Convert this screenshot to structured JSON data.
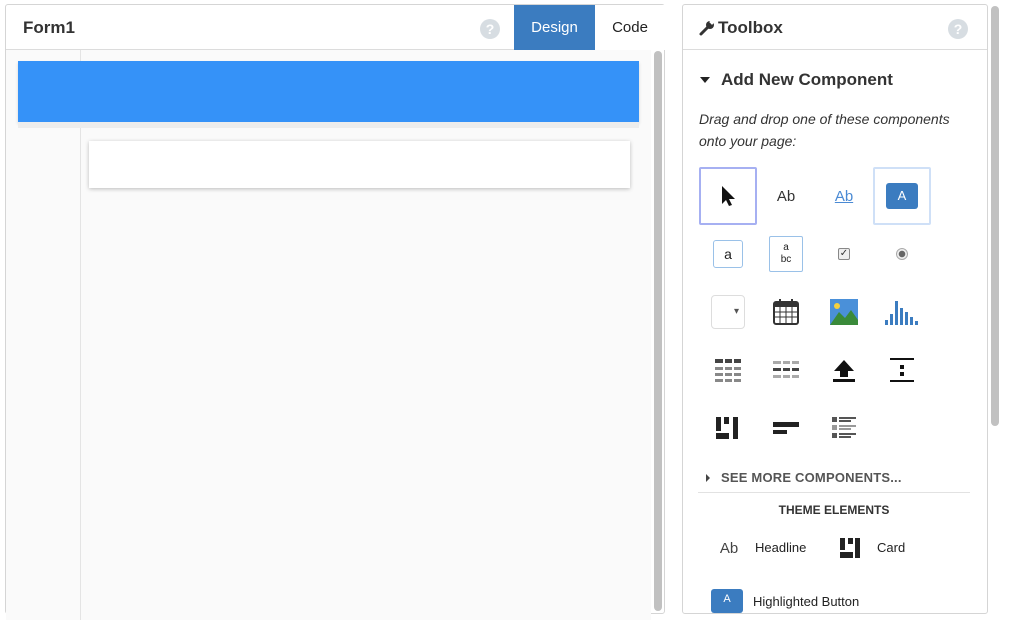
{
  "designer": {
    "title": "Form1",
    "help_glyph": "?",
    "tabs": [
      {
        "label": "Design",
        "active": true
      },
      {
        "label": "Code",
        "active": false
      }
    ]
  },
  "toolbox": {
    "title": "Toolbox",
    "help_glyph": "?",
    "section_title": "Add New Component",
    "instructions": "Drag and drop one of these components onto your page:",
    "components": [
      {
        "name": "pointer",
        "icon": "pointer-icon",
        "label": ""
      },
      {
        "name": "label",
        "icon": "label-icon",
        "label": "Ab"
      },
      {
        "name": "link",
        "icon": "link-icon",
        "label": "Ab"
      },
      {
        "name": "button",
        "icon": "button-icon",
        "label": "A"
      },
      {
        "name": "textbox",
        "icon": "textbox-icon",
        "label": "a"
      },
      {
        "name": "textarea",
        "icon": "textarea-icon",
        "label": "a bc"
      },
      {
        "name": "checkbox",
        "icon": "checkbox-icon",
        "label": ""
      },
      {
        "name": "radio",
        "icon": "radio-icon",
        "label": ""
      },
      {
        "name": "dropdown",
        "icon": "dropdown-icon",
        "label": "▾"
      },
      {
        "name": "datepicker",
        "icon": "calendar-icon",
        "label": ""
      },
      {
        "name": "image",
        "icon": "image-icon",
        "label": ""
      },
      {
        "name": "plot",
        "icon": "chart-icon",
        "label": ""
      },
      {
        "name": "data-grid",
        "icon": "data-grid-icon",
        "label": ""
      },
      {
        "name": "data-row",
        "icon": "data-row-icon",
        "label": ""
      },
      {
        "name": "file-loader",
        "icon": "upload-icon",
        "label": ""
      },
      {
        "name": "spacer",
        "icon": "spacer-icon",
        "label": ""
      },
      {
        "name": "column-panel",
        "icon": "column-panel-icon",
        "label": ""
      },
      {
        "name": "flow-panel",
        "icon": "flow-panel-icon",
        "label": ""
      },
      {
        "name": "repeating-panel",
        "icon": "repeating-panel-icon",
        "label": ""
      }
    ],
    "see_more": "SEE MORE COMPONENTS...",
    "theme_title": "THEME ELEMENTS",
    "theme_items": [
      {
        "label": "Headline",
        "icon": "headline-icon",
        "glyph": "Ab"
      },
      {
        "label": "Card",
        "icon": "card-icon",
        "glyph": ""
      }
    ],
    "partial_item": {
      "label": "Highlighted Button",
      "glyph": "A"
    }
  },
  "colors": {
    "accent": "#3b7cc0",
    "nav_blue": "#3592f8"
  }
}
